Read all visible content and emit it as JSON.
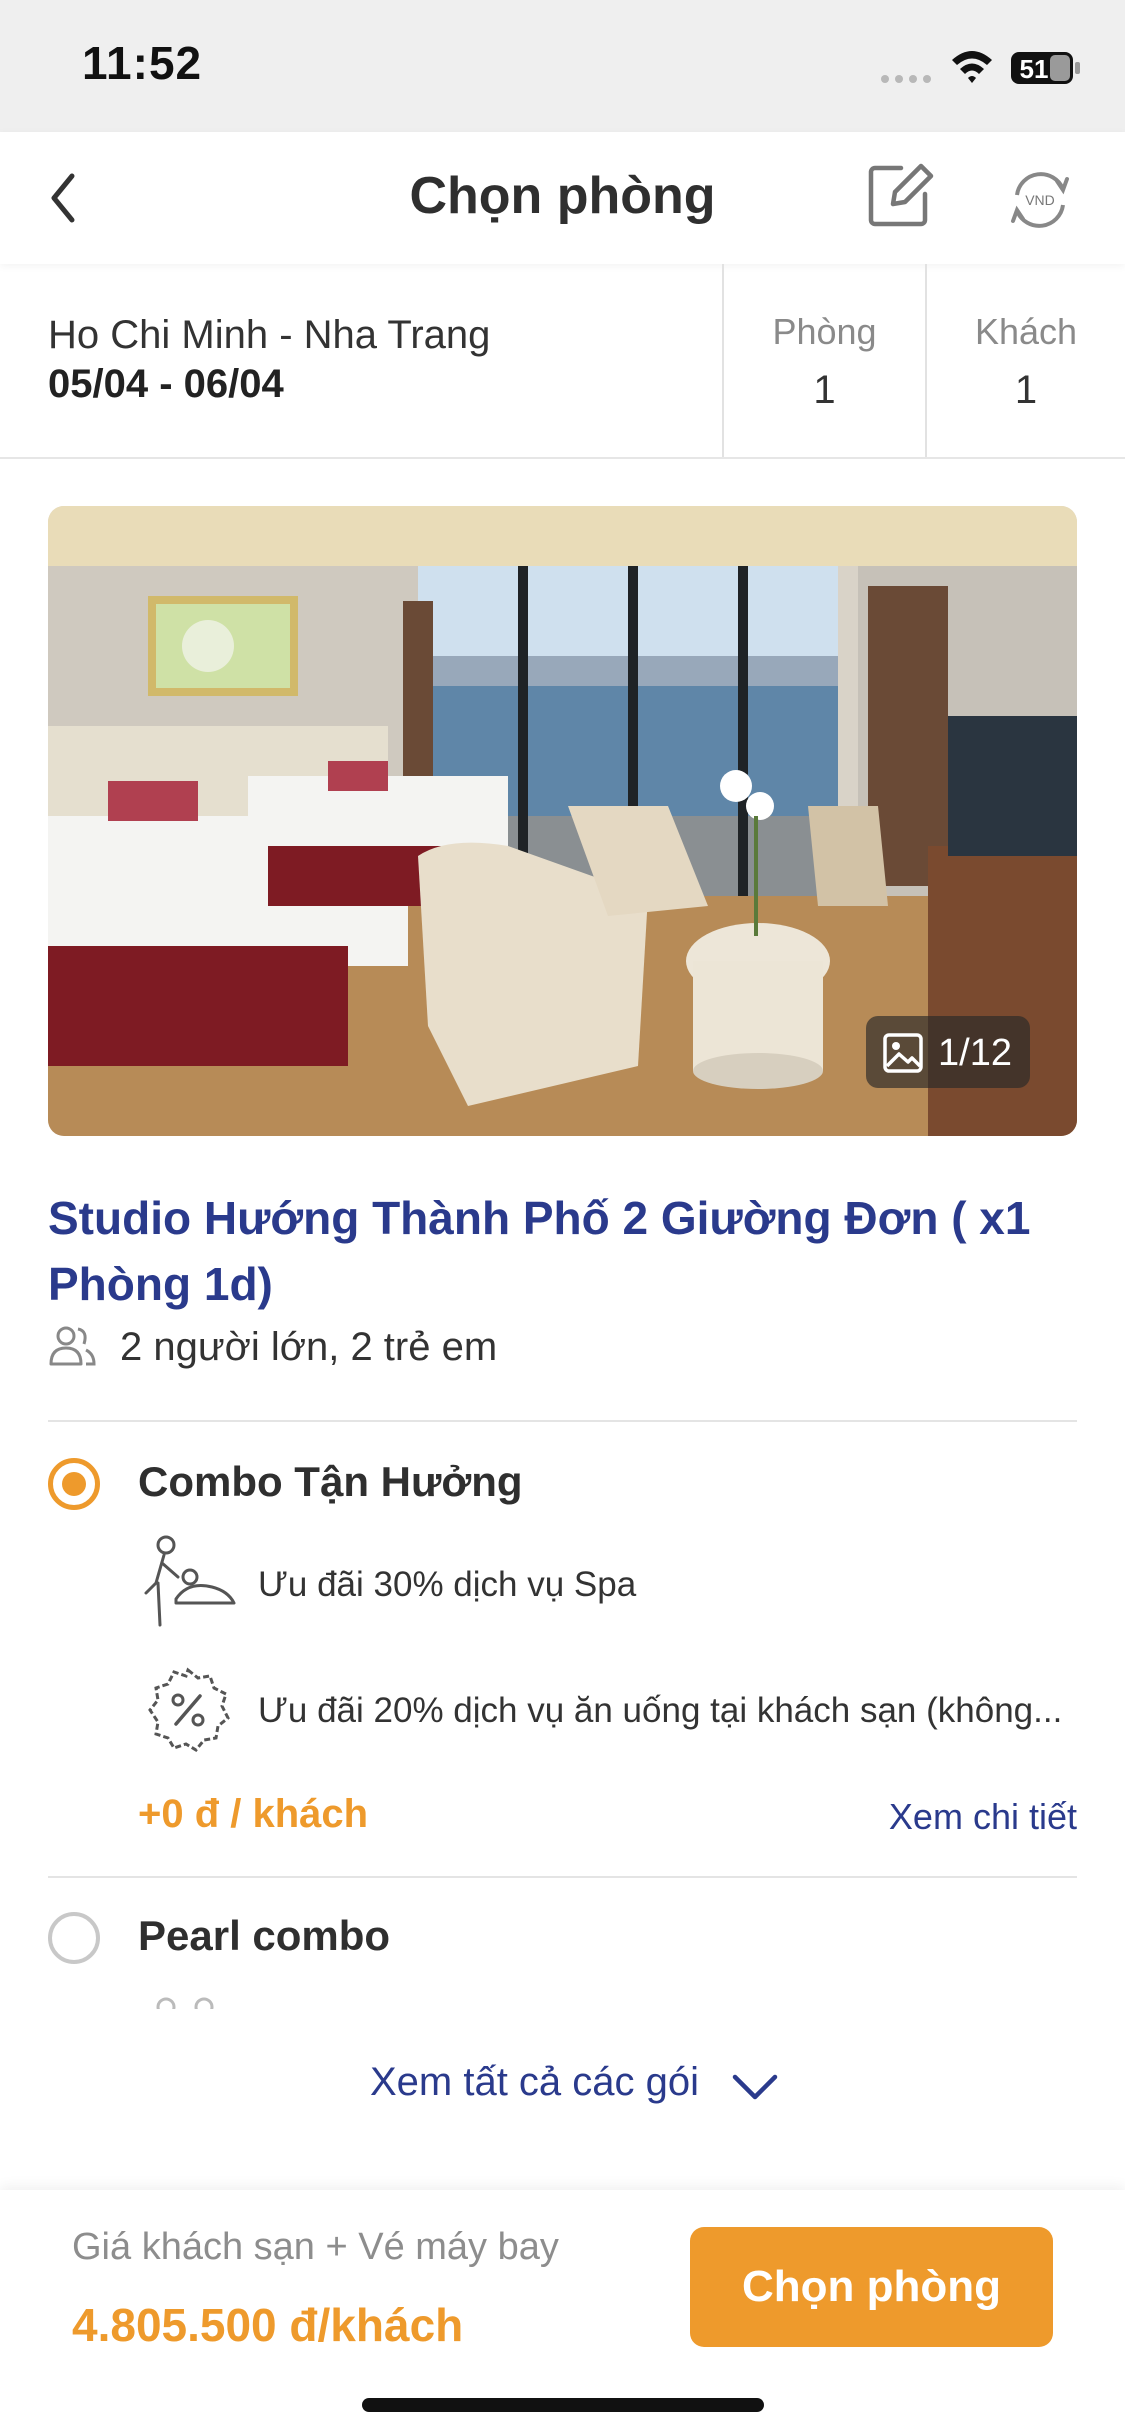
{
  "status_bar": {
    "time": "11:52",
    "battery": "51"
  },
  "header": {
    "title": "Chọn phòng",
    "currency_badge": "VND"
  },
  "trip": {
    "route": "Ho Chi Minh - Nha Trang",
    "dates": "05/04 - 06/04",
    "rooms_label": "Phòng",
    "rooms_value": "1",
    "guests_label": "Khách",
    "guests_value": "1"
  },
  "photo": {
    "counter": "1/12"
  },
  "room": {
    "title": "Studio Hướng Thành Phố 2 Giường Đơn ( x1 Phòng 1d)",
    "occupancy": "2 người lớn, 2 trẻ em"
  },
  "packages": [
    {
      "name": "Combo Tận Hưởng",
      "selected": true,
      "perks": [
        {
          "icon": "spa-massage-icon",
          "text": "Ưu đãi 30% dịch vụ Spa"
        },
        {
          "icon": "discount-badge-icon",
          "text": "Ưu đãi 20% dịch vụ ăn uống tại khách sạn (không..."
        }
      ],
      "price": "+0 đ / khách",
      "detail_link": "Xem chi tiết"
    },
    {
      "name": "Pearl combo",
      "selected": false
    }
  ],
  "see_all": "Xem tất cả các gói",
  "footer": {
    "price_label": "Giá khách sạn + Vé máy bay",
    "price_value": "4.805.500 đ/khách",
    "cta": "Chọn phòng"
  },
  "colors": {
    "accent": "#ee9a2c",
    "link": "#2a3a8c"
  }
}
